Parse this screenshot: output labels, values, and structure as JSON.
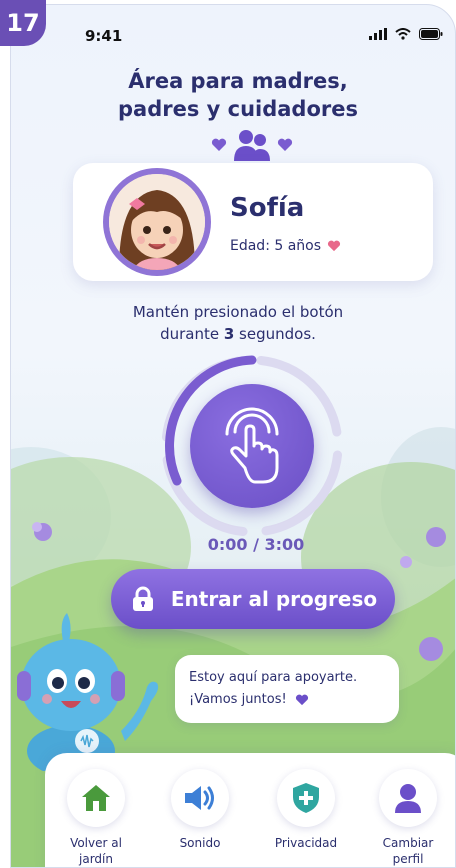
{
  "badge": "17",
  "status": {
    "time": "9:41"
  },
  "header": {
    "title_line1": "Área para madres,",
    "title_line2": "padres y cuidadores"
  },
  "profile": {
    "name": "Sofía",
    "age": "Edad: 5 años"
  },
  "instruction": {
    "text_before": "Mantén presionado el botón",
    "text_mid": "durante ",
    "seconds": "3",
    "text_after": " segundos."
  },
  "hold": {
    "timer": "0:00 / 3:00"
  },
  "enter_button": {
    "label": "Entrar al progreso"
  },
  "speech": {
    "line1": "Estoy aquí para apoyarte.",
    "line2": "¡Vamos juntos!"
  },
  "nav": {
    "items": [
      {
        "label_l1": "Volver al",
        "label_l2": "jardín",
        "icon": "home-icon"
      },
      {
        "label_l1": "Sonido",
        "label_l2": "",
        "icon": "speaker-icon"
      },
      {
        "label_l1": "Privacidad",
        "label_l2": "",
        "icon": "shield-icon"
      },
      {
        "label_l1": "Cambiar",
        "label_l2": "perfil",
        "icon": "user-icon"
      }
    ]
  },
  "colors": {
    "primary": "#6b4fc9",
    "text": "#2b2f6e",
    "heart_pink": "#e8688a",
    "home_green": "#4a9a3c",
    "shield_teal": "#2fa6a0"
  }
}
